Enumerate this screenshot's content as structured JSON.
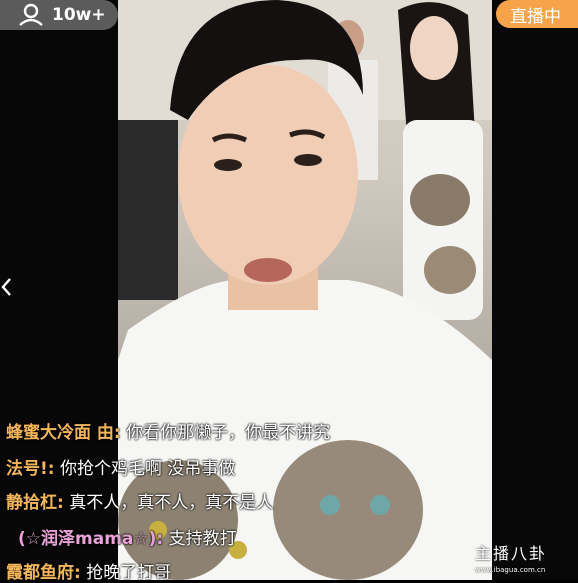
{
  "viewers": {
    "icon": "user-icon",
    "count": "10w+"
  },
  "live_badge": {
    "label": "直播中"
  },
  "chat": [
    {
      "user": "蜂蜜大冷面 由:",
      "message": "你看你那懒子，你最不讲究",
      "user_color": "#f4b65a"
    },
    {
      "user": "法号!:",
      "message": "你抢个鸡毛啊 没吊事做",
      "user_color": "#f4b65a"
    },
    {
      "user": "静拾杠:",
      "message": "真不人，真不人，真不是人",
      "user_color": "#f4b65a"
    },
    {
      "user": "(☆润泽mama☆):",
      "message": "支持教打",
      "user_color": "#e9a2d6"
    },
    {
      "user": "霞都鱼府:",
      "message": "抢晚了打哥",
      "user_color": "#f4b65a"
    }
  ],
  "watermark": {
    "brand": "主播八卦",
    "url": "www.ibagua.com.cn"
  },
  "colors": {
    "accent": "#f7a34a",
    "pill_gray": "#787878"
  }
}
